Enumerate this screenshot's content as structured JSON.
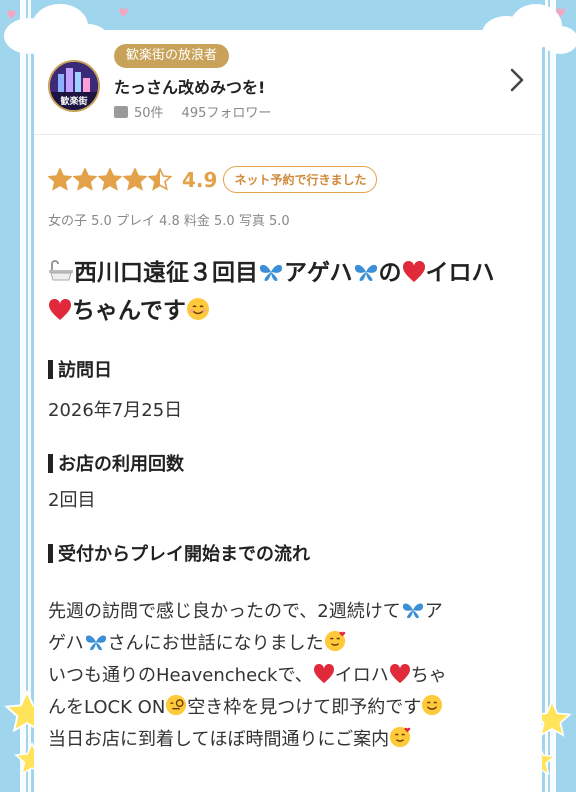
{
  "profile": {
    "title_badge": "歓楽街の放浪者",
    "user_name": "たっさん改めみつを!",
    "review_count": "50件",
    "followers": "495フォロワー",
    "avatar_text": "歓楽街"
  },
  "rating": {
    "stars_filled": 4.5,
    "value": "4.9",
    "net_badge": "ネット予約で行きました",
    "sub": "女の子 5.0  プレイ 4.8  料金 5.0  写真 5.0"
  },
  "review": {
    "title_parts": [
      "西川口遠征３回目",
      "アゲハ",
      "の",
      "イロハ",
      "ちゃんです"
    ],
    "visit_date_heading": "訪問日",
    "visit_date": "2026年7月25日",
    "visits_heading": "お店の利用回数",
    "visits": "2回目",
    "flow_heading": "受付からプレイ開始までの流れ",
    "flow_l1a": "先週の訪問で感じ良かったので、2週続けて",
    "flow_l1b": "ア",
    "flow_l2a": "ゲハ",
    "flow_l2b": "さんにお世話になりました",
    "flow_l3a": "いつも通りのHeavencheckで、",
    "flow_l3b": "イロハ",
    "flow_l3c": "ちゃ",
    "flow_l4a": "んをLOCK ON",
    "flow_l4b": "空き枠を見つけて即予約です",
    "flow_l5": "当日お店に到着してほぼ時間通りにご案内"
  },
  "colors": {
    "background": "#9fd6ee",
    "gold": "#c9a25a",
    "star": "#e3a14a",
    "butterfly": "#3a8fd6",
    "heart": "#e0293a"
  },
  "icons": [
    "bathtub-icon",
    "butterfly-icon",
    "heart-icon",
    "smile-icon",
    "love-face-icon",
    "chat-icon",
    "chevron-right-icon",
    "star-icon"
  ]
}
